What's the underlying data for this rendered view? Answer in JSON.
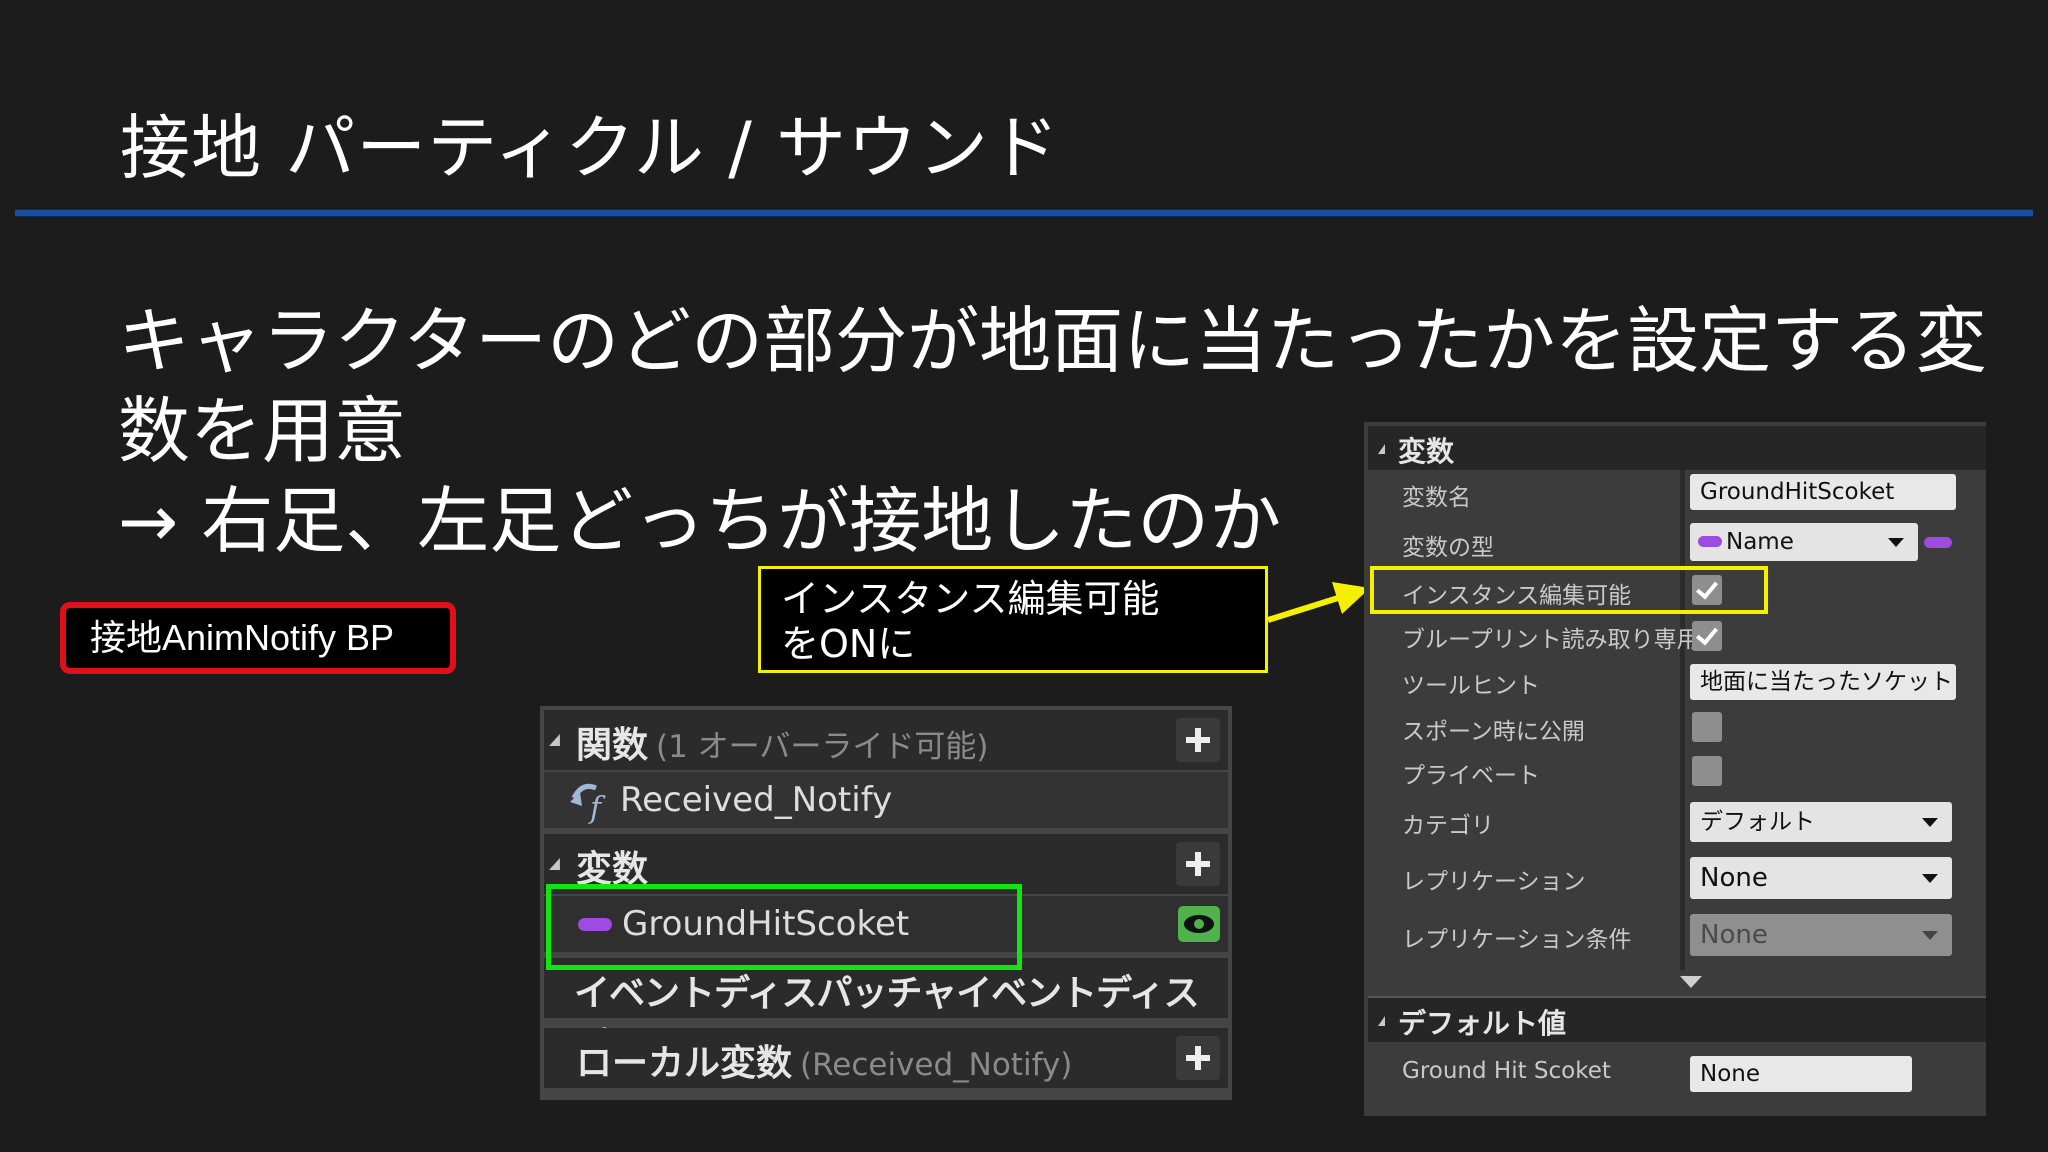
{
  "slide": {
    "title": "接地 パーティクル / サウンド",
    "lines": [
      "キャラクターのどの部分が地面に当たったかを設定する変",
      "数を用意",
      "→ 右足、左足どっちが接地したのか"
    ],
    "bp_label": "接地AnimNotify BP",
    "callout_line1": "インスタンス編集可能",
    "callout_line2": "をONに"
  },
  "colors": {
    "background": "#1c1c1d",
    "title_rule": "#1a4fa0",
    "red_frame": "#e0101a",
    "yellow_frame": "#f5f000",
    "green_frame": "#11e611",
    "name_pill": "#9d4be0"
  },
  "my_blueprint": {
    "functions_header": "関数",
    "functions_note": "(1 オーバーライド可能)",
    "function_item": "Received_Notify",
    "variables_header": "変数",
    "variable_item": "GroundHitScoket",
    "dispatchers_header": "イベントディスパッチャイベントディスパッチャー",
    "local_vars_header": "ローカル変数",
    "local_vars_note": "(Received_Notify)"
  },
  "details": {
    "variable_section": "変数",
    "default_section": "デフォルト値",
    "rows": {
      "var_name": {
        "label": "変数名",
        "value": "GroundHitScoket"
      },
      "var_type": {
        "label": "変数の型",
        "value": "Name"
      },
      "instance_editable": {
        "label": "インスタンス編集可能",
        "checked": true
      },
      "bp_readonly": {
        "label": "ブループリント読み取り専用",
        "checked": true
      },
      "tooltip": {
        "label": "ツールヒント",
        "value": "地面に当たったソケット"
      },
      "expose_spawn": {
        "label": "スポーン時に公開",
        "checked": false
      },
      "private": {
        "label": "プライベート",
        "checked": false
      },
      "category": {
        "label": "カテゴリ",
        "value": "デフォルト"
      },
      "replication": {
        "label": "レプリケーション",
        "value": "None"
      },
      "replication_condition": {
        "label": "レプリケーション条件",
        "value": "None"
      }
    },
    "default_row": {
      "label": "Ground Hit Scoket",
      "value": "None"
    }
  }
}
